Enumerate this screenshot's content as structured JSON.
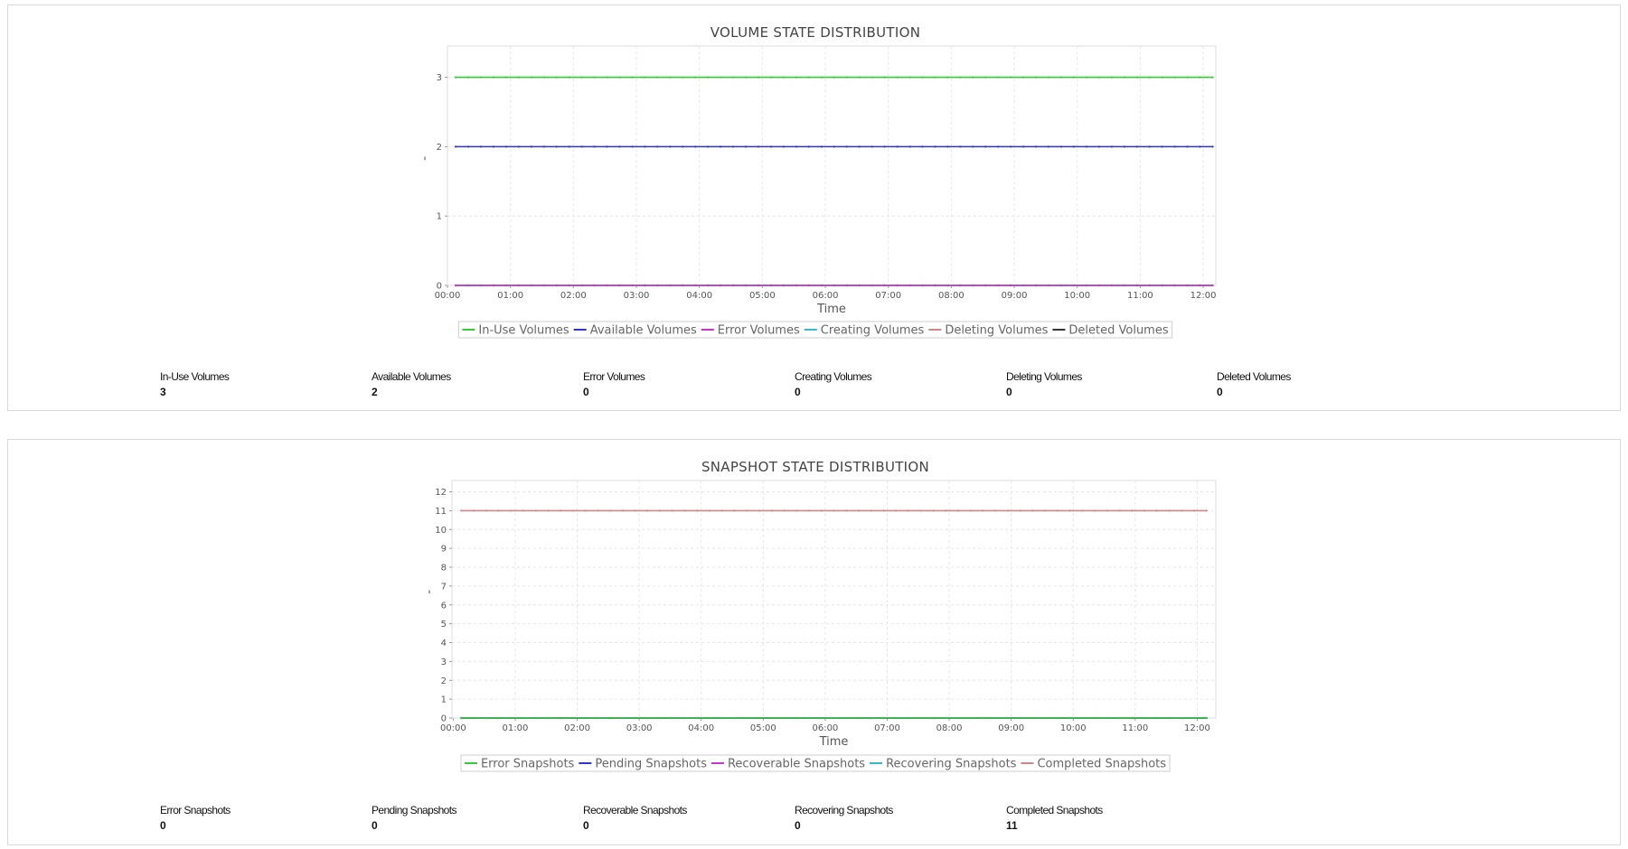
{
  "volume": {
    "chart_data": {
      "type": "line",
      "title": "VOLUME STATE DISTRIBUTION",
      "xlabel": "Time",
      "ylabel": "'",
      "x_ticks": [
        "00:00",
        "01:00",
        "02:00",
        "03:00",
        "04:00",
        "05:00",
        "06:00",
        "07:00",
        "08:00",
        "09:00",
        "10:00",
        "11:00",
        "12:00"
      ],
      "xlim_hours": [
        0,
        12.2
      ],
      "x_start_hours": 0.13,
      "x_end_hours": 12.15,
      "ylim": [
        0,
        3.45
      ],
      "y_ticks": [
        0,
        1,
        2,
        3
      ],
      "grid": true,
      "legend_position": "bottom",
      "series": [
        {
          "name": "In-Use Volumes",
          "color": "#33cc33",
          "value": 3
        },
        {
          "name": "Available Volumes",
          "color": "#3333cc",
          "value": 2
        },
        {
          "name": "Error Volumes",
          "color": "#cc33cc",
          "value": 0
        },
        {
          "name": "Creating Volumes",
          "color": "#33bbcc",
          "value": 0
        },
        {
          "name": "Deleting Volumes",
          "color": "#cc8888",
          "value": 0
        },
        {
          "name": "Deleted Volumes",
          "color": "#333333",
          "value": 0
        }
      ]
    },
    "stats": [
      {
        "label": "In-Use Volumes",
        "value": "3"
      },
      {
        "label": "Available Volumes",
        "value": "2"
      },
      {
        "label": "Error Volumes",
        "value": "0"
      },
      {
        "label": "Creating Volumes",
        "value": "0"
      },
      {
        "label": "Deleting Volumes",
        "value": "0"
      },
      {
        "label": "Deleted Volumes",
        "value": "0"
      }
    ]
  },
  "snapshot": {
    "chart_data": {
      "type": "line",
      "title": "SNAPSHOT STATE DISTRIBUTION",
      "xlabel": "Time",
      "ylabel": "'",
      "x_ticks": [
        "00:00",
        "01:00",
        "02:00",
        "03:00",
        "04:00",
        "05:00",
        "06:00",
        "07:00",
        "08:00",
        "09:00",
        "10:00",
        "11:00",
        "12:00"
      ],
      "xlim_hours": [
        -0.02,
        12.3
      ],
      "x_start_hours": 0.13,
      "x_end_hours": 12.15,
      "ylim": [
        0,
        12.6
      ],
      "y_ticks": [
        0,
        1,
        2,
        3,
        4,
        5,
        6,
        7,
        8,
        9,
        10,
        11,
        12
      ],
      "grid": true,
      "legend_position": "bottom",
      "series": [
        {
          "name": "Error Snapshots",
          "color": "#33cc33",
          "value": 0
        },
        {
          "name": "Pending Snapshots",
          "color": "#3333cc",
          "value": 0
        },
        {
          "name": "Recoverable Snapshots",
          "color": "#cc33cc",
          "value": 0
        },
        {
          "name": "Recovering Snapshots",
          "color": "#33bbcc",
          "value": 0
        },
        {
          "name": "Completed Snapshots",
          "color": "#cc8888",
          "value": 11
        }
      ]
    },
    "stats": [
      {
        "label": "Error Snapshots",
        "value": "0"
      },
      {
        "label": "Pending Snapshots",
        "value": "0"
      },
      {
        "label": "Recoverable Snapshots",
        "value": "0"
      },
      {
        "label": "Recovering Snapshots",
        "value": "0"
      },
      {
        "label": "Completed Snapshots",
        "value": "11"
      }
    ]
  }
}
